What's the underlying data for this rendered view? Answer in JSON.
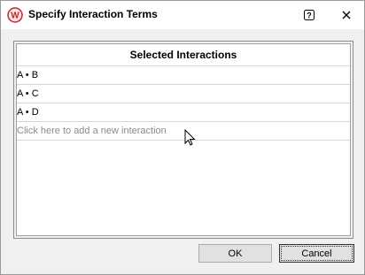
{
  "window": {
    "title": "Specify Interaction Terms",
    "app_icon": "weibull-logo-icon",
    "help_icon": "help-icon",
    "close_glyph": "✕"
  },
  "grid": {
    "header": "Selected Interactions",
    "rows": [
      "A • B",
      "A • C",
      "A • D"
    ],
    "placeholder": "Click here to add a new interaction"
  },
  "buttons": {
    "ok_label": "OK",
    "cancel_label": "Cancel"
  },
  "colors": {
    "accent_red": "#c0282d"
  }
}
